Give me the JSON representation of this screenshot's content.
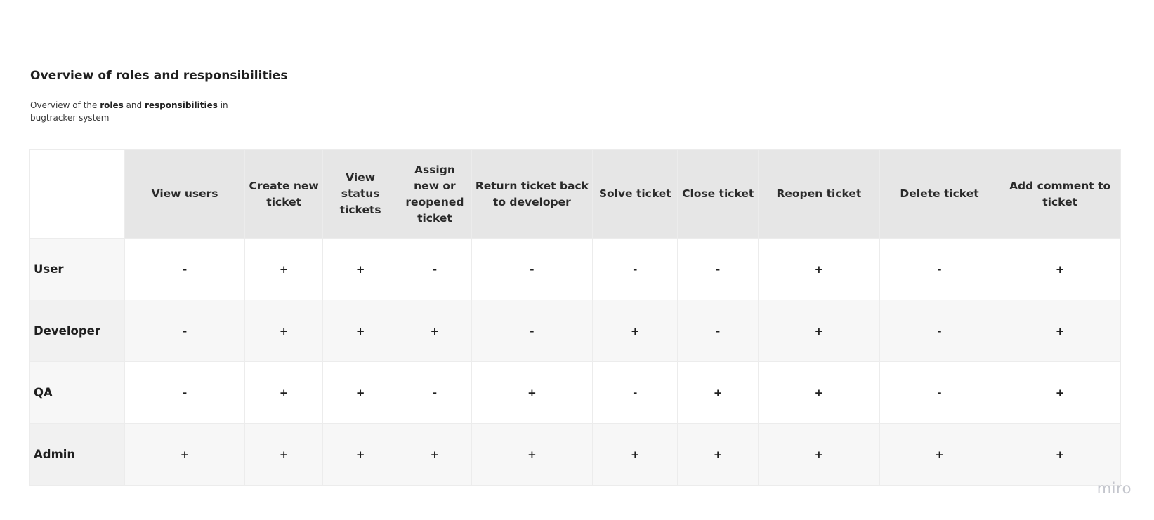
{
  "title": "Overview of roles and responsibilities",
  "description": {
    "prefix": "Overview of the ",
    "bold1": "roles",
    "middle": " and ",
    "bold2": "responsibilities",
    "suffix": " in bugtracker system"
  },
  "table": {
    "columns": [
      "View users",
      "Create new ticket",
      "View status tickets",
      "Assign new or reopened ticket",
      "Return ticket back to developer",
      "Solve ticket",
      "Close ticket",
      "Reopen ticket",
      "Delete ticket",
      "Add comment to ticket"
    ],
    "rows": [
      {
        "role": "User",
        "cells": [
          "-",
          "+",
          "+",
          "-",
          "-",
          "-",
          "-",
          "+",
          "-",
          "+"
        ]
      },
      {
        "role": "Developer",
        "cells": [
          "-",
          "+",
          "+",
          "+",
          "-",
          "+",
          "-",
          "+",
          "-",
          "+"
        ]
      },
      {
        "role": "QA",
        "cells": [
          "-",
          "+",
          "+",
          "-",
          "+",
          "-",
          "+",
          "+",
          "-",
          "+"
        ]
      },
      {
        "role": "Admin",
        "cells": [
          "+",
          "+",
          "+",
          "+",
          "+",
          "+",
          "+",
          "+",
          "+",
          "+"
        ]
      }
    ]
  },
  "watermark": "miro"
}
